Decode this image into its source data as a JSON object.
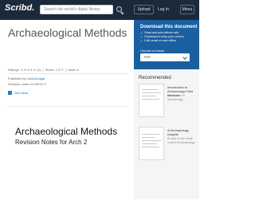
{
  "header": {
    "logo": "Scribd.",
    "search_placeholder": "Search the world's digital library",
    "upload_label": "Upload",
    "login_label": "Log In",
    "menu_label": "Menu"
  },
  "document": {
    "title": "Archaeological Methods",
    "ratings_label": "Ratings:",
    "stars": "★★★★★",
    "ratings_count": "(1)",
    "views_label": "Views: 2,277",
    "likes_label": "Likes: 6",
    "published_by_label": "Published by",
    "publisher": "JoMcDougal",
    "notes": "Revision notes for ARCH 2",
    "read_more": "See More",
    "page_title": "Archaeological Methods",
    "page_subtitle": "Revision Notes for Arch 2"
  },
  "sidebar": {
    "promo_heading": "Download this document",
    "promo_items": [
      "Read and print without ads",
      "Download to keep your version",
      "Edit, email or read offline"
    ],
    "choose_format_label": "Choose a format:",
    "format_value": ".PDF",
    "recommended_heading": "Recommended",
    "recommended": [
      {
        "title": "Introduction to Archaeology Field Methods",
        "subtitle": "Introduction to Archaeology"
      },
      {
        "title": "AI Archaeology Insights",
        "subtitle": "AI data for the credit control of Archaeology"
      }
    ]
  },
  "colors": {
    "topbar": "#1b2a3a",
    "promo": "#1a5fa0",
    "link": "#1a6fb5"
  }
}
